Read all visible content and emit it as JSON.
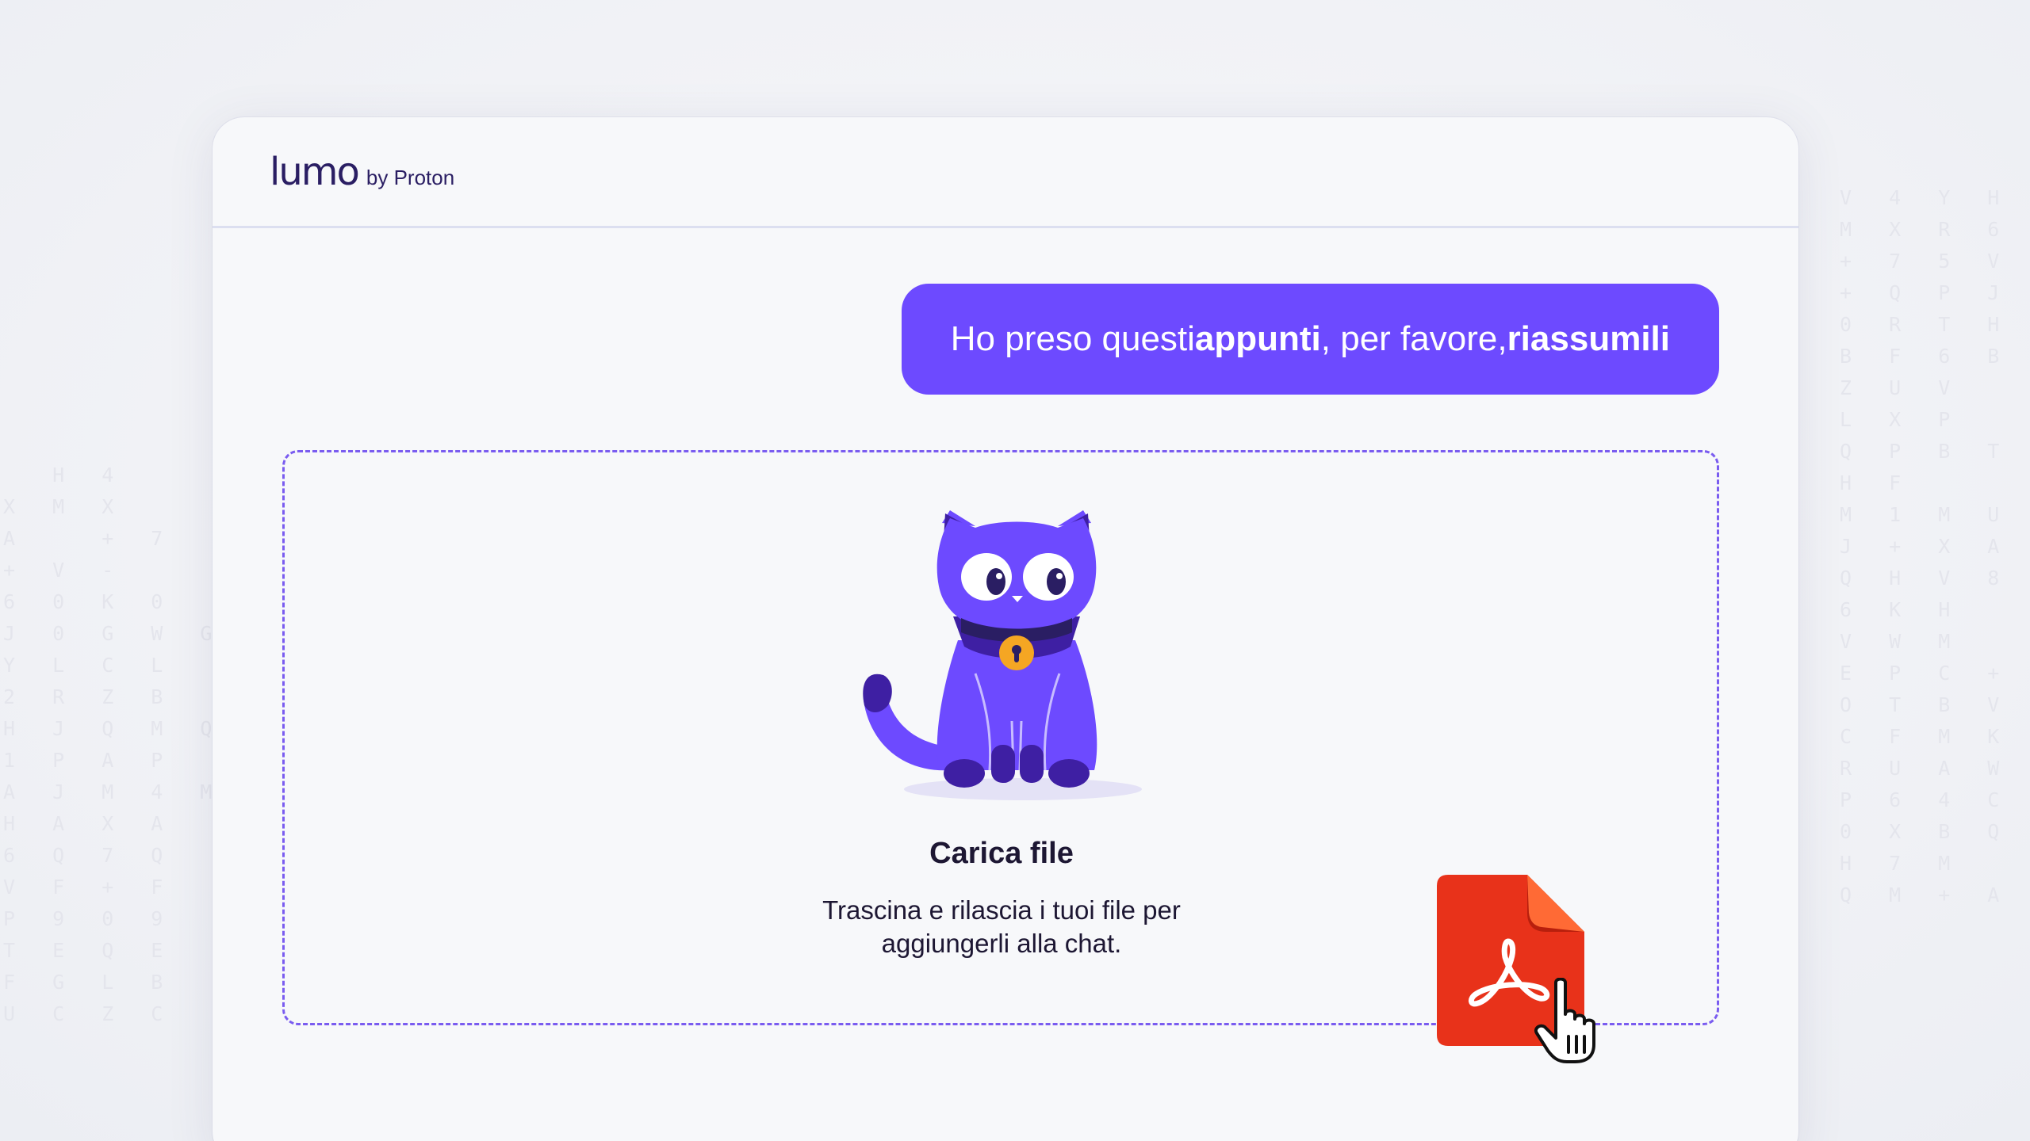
{
  "app": {
    "logo_word": "lumo",
    "logo_by": "by Proton"
  },
  "chat": {
    "message_parts": [
      {
        "text": "Ho preso questi ",
        "bold": false
      },
      {
        "text": "appunti",
        "bold": true
      },
      {
        "text": ", per favore, ",
        "bold": false
      },
      {
        "text": "riassumili",
        "bold": true
      }
    ]
  },
  "upload": {
    "title": "Carica file",
    "description": "Trascina e rilascia i tuoi file per aggiungerli alla chat.",
    "mascot": "cat-mascot-icon",
    "file_icon": "pdf-file-icon",
    "cursor_icon": "hand-pointer-icon"
  },
  "colors": {
    "accent": "#6d4aff",
    "pdf_red": "#e8321a",
    "pdf_corner": "#ff6a35",
    "text_dark": "#1d1733",
    "logo": "#2a1e63",
    "bell": "#f5a623"
  }
}
